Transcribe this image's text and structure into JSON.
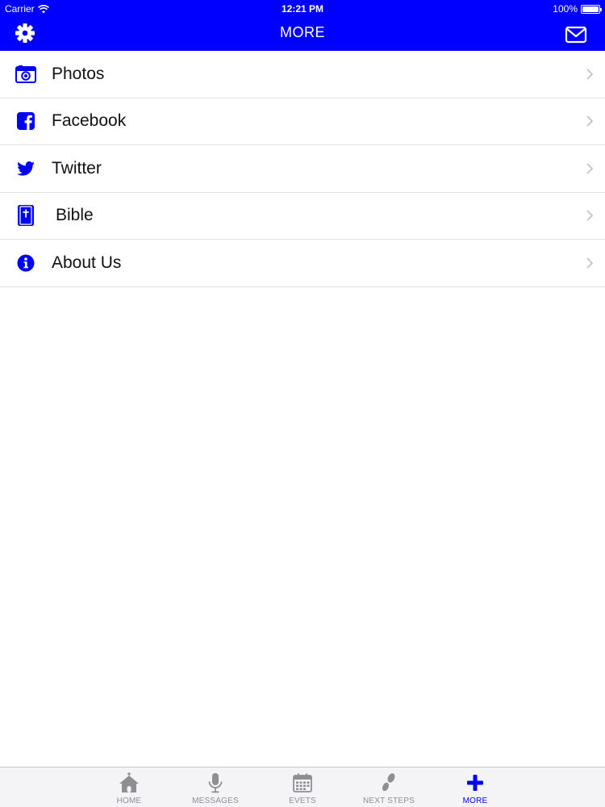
{
  "status_bar": {
    "carrier": "Carrier",
    "time": "12:21 PM",
    "battery": "100%",
    "battery_level": 1.0
  },
  "navbar": {
    "title": "MORE",
    "left_icon": "gear-icon",
    "right_icon": "mail-icon"
  },
  "menu": {
    "items": [
      {
        "label": "Photos",
        "icon": "camera-icon"
      },
      {
        "label": "Facebook",
        "icon": "facebook-icon"
      },
      {
        "label": "Twitter",
        "icon": "twitter-icon"
      },
      {
        "label": "Bible",
        "icon": "bible-icon"
      },
      {
        "label": "About Us",
        "icon": "info-icon"
      }
    ]
  },
  "tabbar": {
    "tabs": [
      {
        "label": "HOME",
        "icon": "church-icon",
        "active": false
      },
      {
        "label": "MESSAGES",
        "icon": "microphone-icon",
        "active": false
      },
      {
        "label": "EVETS",
        "icon": "calendar-icon",
        "active": false
      },
      {
        "label": "NEXT STEPS",
        "icon": "footsteps-icon",
        "active": false
      },
      {
        "label": "MORE",
        "icon": "plus-icon",
        "active": true
      }
    ]
  },
  "colors": {
    "accent": "#0000ff",
    "inactive_tab": "#8e8e93",
    "separator": "#e2e2e2"
  }
}
